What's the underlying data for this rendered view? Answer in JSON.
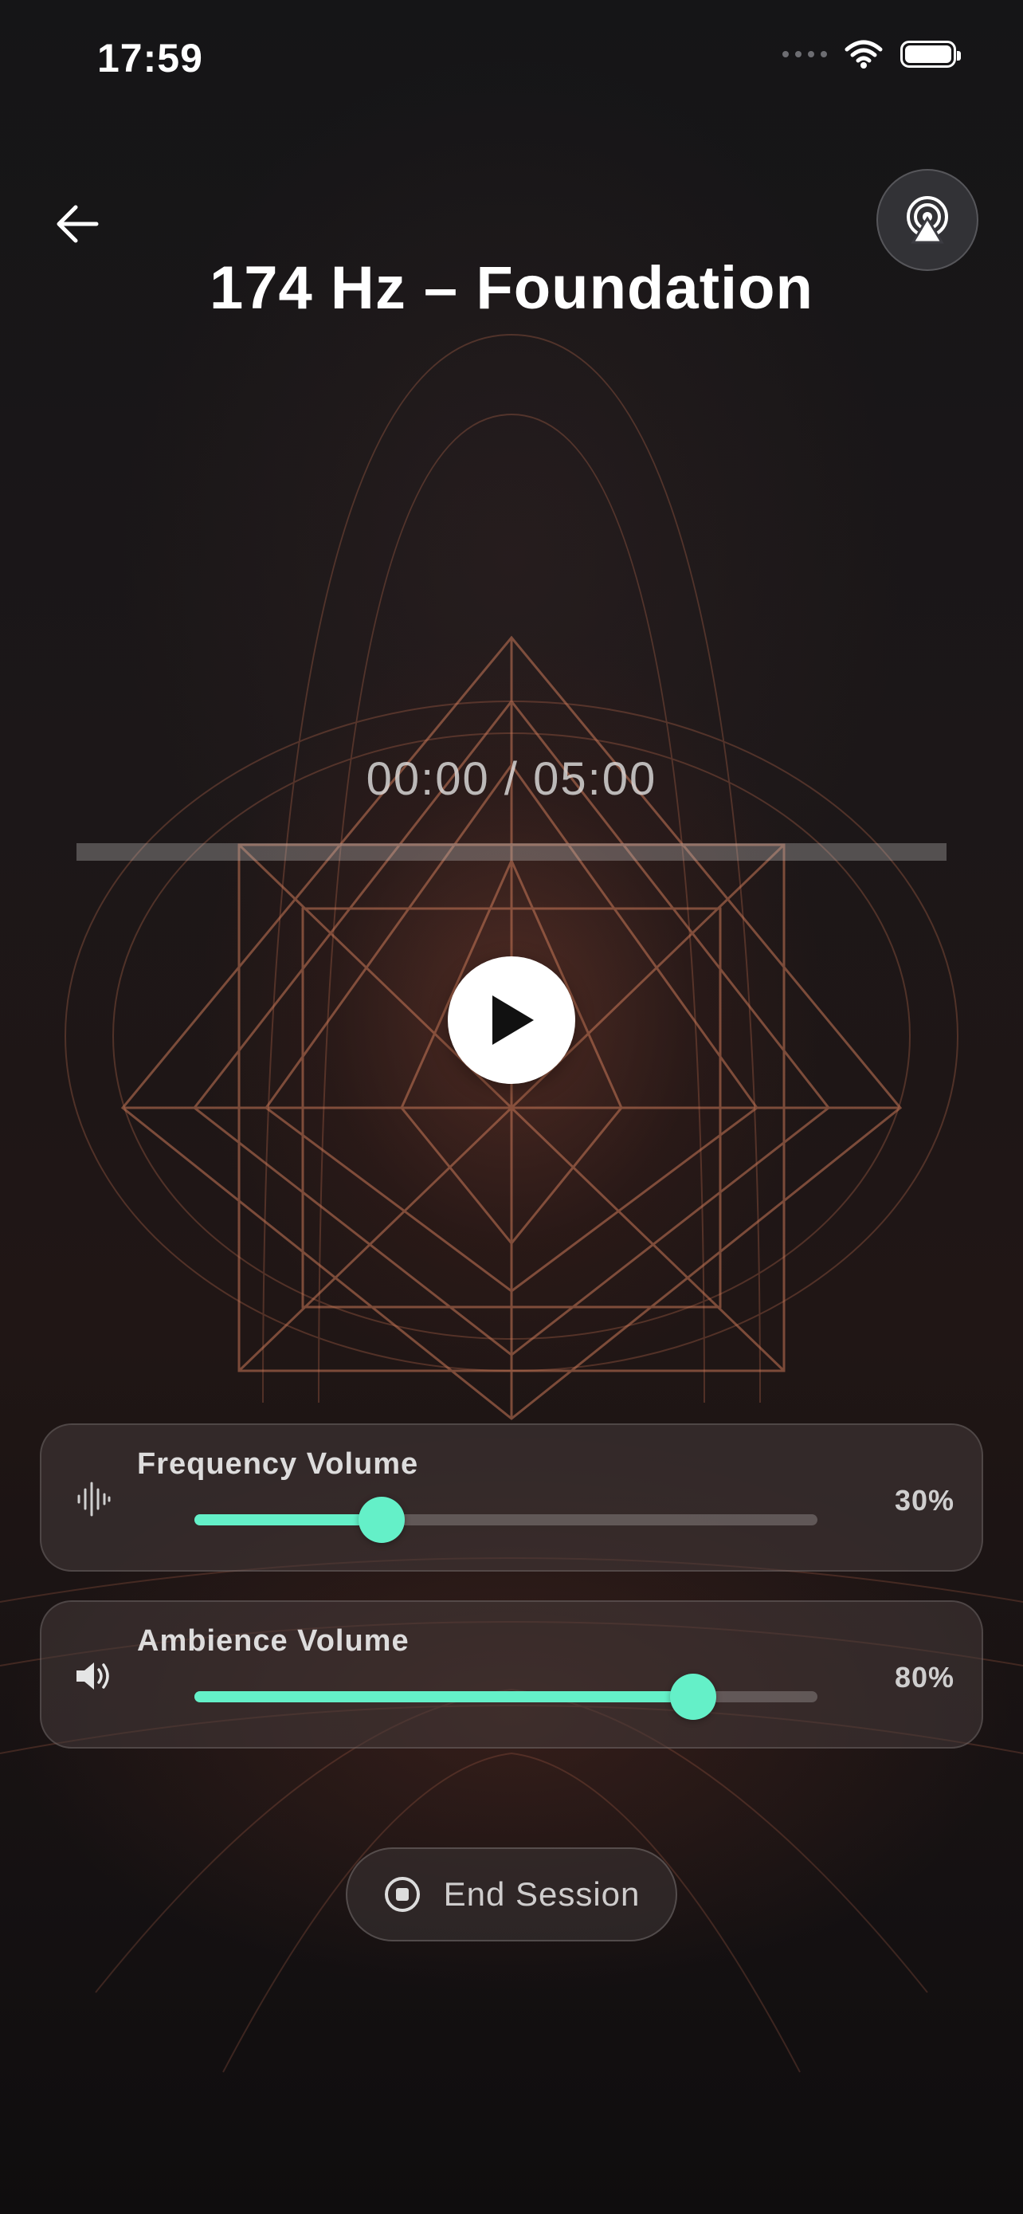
{
  "status_bar": {
    "time": "17:59",
    "icons": [
      "signal-dots-icon",
      "wifi-icon",
      "battery-icon"
    ]
  },
  "header": {
    "title": "174 Hz – Foundation",
    "back_icon": "arrow-left-icon",
    "cast_icon": "airplay-icon"
  },
  "player": {
    "time_readout": "00:00 / 05:00",
    "progress_fraction": 0,
    "play_icon": "play-icon"
  },
  "volumes": [
    {
      "label": "Frequency Volume",
      "value_text": "30%",
      "value_fraction": 0.3,
      "icon": "waveform-icon"
    },
    {
      "label": "Ambience Volume",
      "value_text": "80%",
      "value_fraction": 0.8,
      "icon": "speaker-icon"
    }
  ],
  "end_session": {
    "label": "End Session",
    "icon": "stop-circle-icon"
  },
  "colors": {
    "accent": "#64f0c8",
    "background": "#1c1718",
    "ornament": "#b0644a"
  }
}
